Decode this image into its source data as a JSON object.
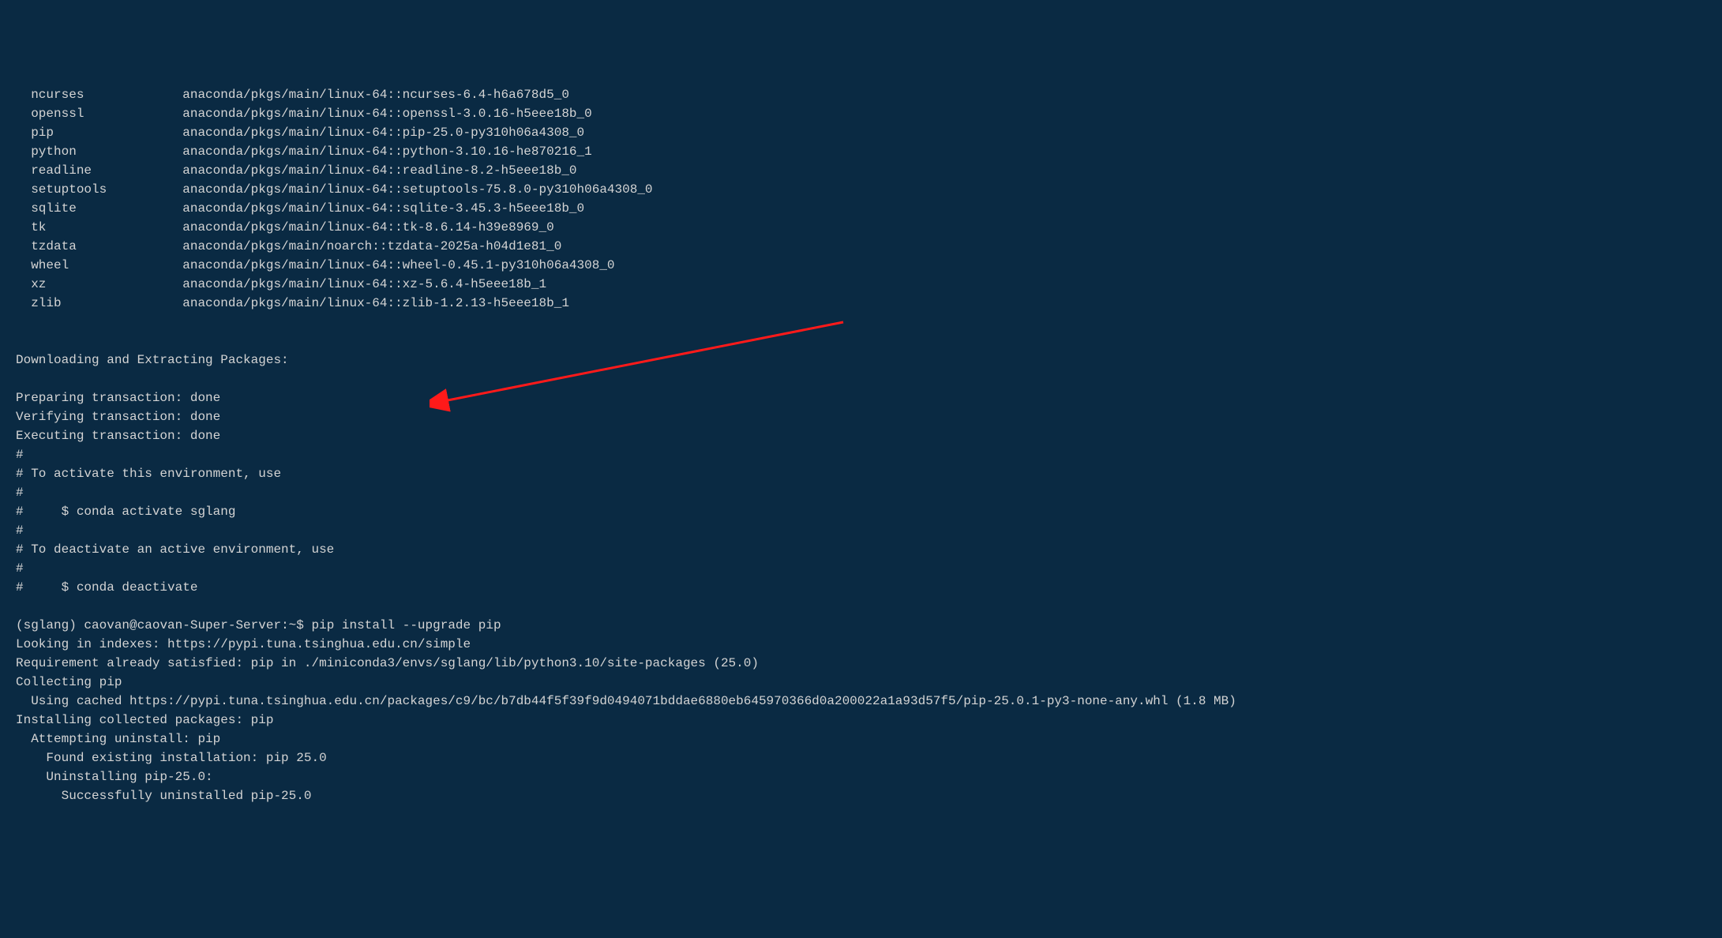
{
  "packages": [
    {
      "name": "ncurses",
      "spec": "anaconda/pkgs/main/linux-64::ncurses-6.4-h6a678d5_0"
    },
    {
      "name": "openssl",
      "spec": "anaconda/pkgs/main/linux-64::openssl-3.0.16-h5eee18b_0"
    },
    {
      "name": "pip",
      "spec": "anaconda/pkgs/main/linux-64::pip-25.0-py310h06a4308_0"
    },
    {
      "name": "python",
      "spec": "anaconda/pkgs/main/linux-64::python-3.10.16-he870216_1"
    },
    {
      "name": "readline",
      "spec": "anaconda/pkgs/main/linux-64::readline-8.2-h5eee18b_0"
    },
    {
      "name": "setuptools",
      "spec": "anaconda/pkgs/main/linux-64::setuptools-75.8.0-py310h06a4308_0"
    },
    {
      "name": "sqlite",
      "spec": "anaconda/pkgs/main/linux-64::sqlite-3.45.3-h5eee18b_0"
    },
    {
      "name": "tk",
      "spec": "anaconda/pkgs/main/linux-64::tk-8.6.14-h39e8969_0"
    },
    {
      "name": "tzdata",
      "spec": "anaconda/pkgs/main/noarch::tzdata-2025a-h04d1e81_0"
    },
    {
      "name": "wheel",
      "spec": "anaconda/pkgs/main/linux-64::wheel-0.45.1-py310h06a4308_0"
    },
    {
      "name": "xz",
      "spec": "anaconda/pkgs/main/linux-64::xz-5.6.4-h5eee18b_1"
    },
    {
      "name": "zlib",
      "spec": "anaconda/pkgs/main/linux-64::zlib-1.2.13-h5eee18b_1"
    }
  ],
  "download_header": "Downloading and Extracting Packages:",
  "transactions": [
    "Preparing transaction: done",
    "Verifying transaction: done",
    "Executing transaction: done"
  ],
  "activation_lines": [
    "#",
    "# To activate this environment, use",
    "#",
    "#     $ conda activate sglang",
    "#",
    "# To deactivate an active environment, use",
    "#",
    "#     $ conda deactivate"
  ],
  "prompt": {
    "env": "(sglang)",
    "userhost": "caovan@caovan-Super-Server",
    "path": "~",
    "symbol": "$",
    "command": "pip install --upgrade pip"
  },
  "pip_output": [
    "Looking in indexes: https://pypi.tuna.tsinghua.edu.cn/simple",
    "Requirement already satisfied: pip in ./miniconda3/envs/sglang/lib/python3.10/site-packages (25.0)",
    "Collecting pip",
    "  Using cached https://pypi.tuna.tsinghua.edu.cn/packages/c9/bc/b7db44f5f39f9d0494071bddae6880eb645970366d0a200022a1a93d57f5/pip-25.0.1-py3-none-any.whl (1.8 MB)",
    "Installing collected packages: pip",
    "  Attempting uninstall: pip",
    "    Found existing installation: pip 25.0",
    "    Uninstalling pip-25.0:",
    "      Successfully uninstalled pip-25.0"
  ],
  "arrow": {
    "color": "#ff1a1a"
  }
}
